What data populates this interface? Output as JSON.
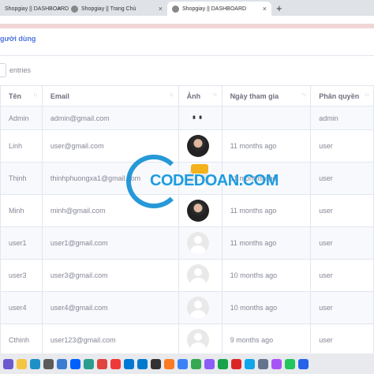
{
  "browser": {
    "tabs": [
      {
        "label": "Shopgiay || DASHBOARD",
        "active": false
      },
      {
        "label": "Shopgiay || Trang Chủ",
        "active": false
      },
      {
        "label": "Shopgiay || DASHBOARD",
        "active": true
      }
    ],
    "close_glyph": "×",
    "new_tab_glyph": "+"
  },
  "page": {
    "title": "gười dùng",
    "entries_label": "entries"
  },
  "table": {
    "columns": [
      "Tên",
      "Email",
      "Ảnh",
      "Ngày tham gia",
      "Phân quyền"
    ],
    "sort_glyph": "↑↓",
    "rows": [
      {
        "name": "Admin",
        "email": "admin@gmail.com",
        "image": "tiny",
        "joined": "",
        "role": "admin"
      },
      {
        "name": "Linh",
        "email": "user@gmail.com",
        "image": "photo",
        "joined": "11 months ago",
        "role": "user"
      },
      {
        "name": "Thịnh",
        "email": "thinhphuongxa1@gmail.com",
        "image": "default",
        "joined": "11 months ago",
        "role": "user"
      },
      {
        "name": "Minh",
        "email": "minh@gmail.com",
        "image": "photo",
        "joined": "11 months ago",
        "role": "user"
      },
      {
        "name": "user1",
        "email": "user1@gmail.com",
        "image": "default",
        "joined": "11 months ago",
        "role": "user"
      },
      {
        "name": "user3",
        "email": "user3@gmail.com",
        "image": "default",
        "joined": "10 months ago",
        "role": "user"
      },
      {
        "name": "user4",
        "email": "user4@gmail.com",
        "image": "default",
        "joined": "10 months ago",
        "role": "user"
      },
      {
        "name": "Cthinh",
        "email": "user123@gmail.com",
        "image": "default",
        "joined": "9 months ago",
        "role": "user"
      }
    ]
  },
  "watermark": {
    "text": "CODEDOAN.COM",
    "color": "#1c9ce0"
  },
  "taskbar": {
    "icons": [
      {
        "name": "chat-icon",
        "color": "#6a5acd"
      },
      {
        "name": "folder-icon",
        "color": "#f4c542"
      },
      {
        "name": "edge-icon",
        "color": "#1e90c8"
      },
      {
        "name": "settings-icon",
        "color": "#5b5b5b"
      },
      {
        "name": "store-icon",
        "color": "#3c7bd1"
      },
      {
        "name": "dropbox-icon",
        "color": "#0061fe"
      },
      {
        "name": "app-icon",
        "color": "#2a9d8f"
      },
      {
        "name": "chrome-icon",
        "color": "#e0443e"
      },
      {
        "name": "vivaldi-icon",
        "color": "#ef3939"
      },
      {
        "name": "mail-icon",
        "color": "#0078d4"
      },
      {
        "name": "vscode-icon",
        "color": "#007acc"
      },
      {
        "name": "terminal-icon",
        "color": "#333333"
      },
      {
        "name": "xampp-icon",
        "color": "#fb7a24"
      },
      {
        "name": "app2-icon",
        "color": "#3b82f6"
      },
      {
        "name": "chrome2-icon",
        "color": "#34a853"
      },
      {
        "name": "app3-icon",
        "color": "#8b5cf6"
      },
      {
        "name": "app4-icon",
        "color": "#16a34a"
      },
      {
        "name": "app5-icon",
        "color": "#dc2626"
      },
      {
        "name": "app6-icon",
        "color": "#0ea5e9"
      },
      {
        "name": "app7-icon",
        "color": "#64748b"
      },
      {
        "name": "app8-icon",
        "color": "#a855f7"
      },
      {
        "name": "app9-icon",
        "color": "#22c55e"
      },
      {
        "name": "app10-icon",
        "color": "#2563eb"
      }
    ]
  }
}
